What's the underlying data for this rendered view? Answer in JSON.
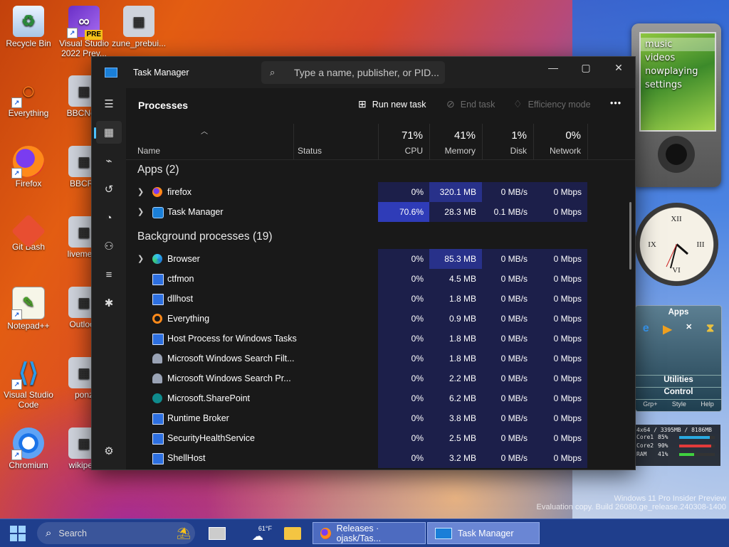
{
  "desktop": {
    "icons": [
      {
        "label": "Recycle Bin",
        "icon": "recycle-bin-icon"
      },
      {
        "label": "Visual Studio 2022 Prev...",
        "icon": "visual-studio-preview-icon",
        "badge": "PRE"
      },
      {
        "label": "zune_prebui...",
        "icon": "zune-prebuilt-icon"
      },
      {
        "label": "Everything",
        "icon": "everything-search-icon"
      },
      {
        "label": "BBCNew",
        "icon": "bbc-news-icon"
      },
      {
        "label": "Firefox",
        "icon": "firefox-icon"
      },
      {
        "label": "BBCRa",
        "icon": "bbc-radio-icon"
      },
      {
        "label": "Git Bash",
        "icon": "git-bash-icon"
      },
      {
        "label": "livemess",
        "icon": "livemessenger-icon"
      },
      {
        "label": "Notepad++",
        "icon": "notepad-plus-plus-icon"
      },
      {
        "label": "Outlook",
        "icon": "outlook-icon"
      },
      {
        "label": "Visual Studio Code",
        "icon": "vscode-icon"
      },
      {
        "label": "ponz",
        "icon": "ponz-icon"
      },
      {
        "label": "Chromium",
        "icon": "chromium-icon"
      },
      {
        "label": "wikipedi",
        "icon": "wikipedia-icon"
      }
    ]
  },
  "window": {
    "title": "Task Manager",
    "search_placeholder": "Type a name, publisher, or PID...",
    "controls": {
      "minimize": "—",
      "maximize": "▢",
      "close": "✕"
    }
  },
  "toolbar": {
    "page_title": "Processes",
    "run_new_task": "Run new task",
    "end_task": "End task",
    "efficiency_mode": "Efficiency mode",
    "more": "•••"
  },
  "columns": {
    "name": "Name",
    "status": "Status",
    "cpu": {
      "pct": "71%",
      "label": "CPU"
    },
    "memory": {
      "pct": "41%",
      "label": "Memory"
    },
    "disk": {
      "pct": "1%",
      "label": "Disk"
    },
    "network": {
      "pct": "0%",
      "label": "Network"
    }
  },
  "sections": {
    "apps": "Apps (2)",
    "background": "Background processes (19)"
  },
  "apps": [
    {
      "name": "firefox",
      "cpu": "0%",
      "memory": "320.1 MB",
      "disk": "0 MB/s",
      "network": "0 Mbps",
      "icon": "firefox-icon",
      "expandable": true
    },
    {
      "name": "Task Manager",
      "cpu": "70.6%",
      "memory": "28.3 MB",
      "disk": "0.1 MB/s",
      "network": "0 Mbps",
      "icon": "task-manager-icon",
      "expandable": true
    }
  ],
  "background": [
    {
      "name": "Browser",
      "cpu": "0%",
      "memory": "85.3 MB",
      "disk": "0 MB/s",
      "network": "0 Mbps",
      "icon": "edge-icon",
      "expandable": true
    },
    {
      "name": "ctfmon",
      "cpu": "0%",
      "memory": "4.5 MB",
      "disk": "0 MB/s",
      "network": "0 Mbps",
      "icon": "app-window-icon",
      "expandable": false
    },
    {
      "name": "dllhost",
      "cpu": "0%",
      "memory": "1.8 MB",
      "disk": "0 MB/s",
      "network": "0 Mbps",
      "icon": "app-window-icon",
      "expandable": false
    },
    {
      "name": "Everything",
      "cpu": "0%",
      "memory": "0.9 MB",
      "disk": "0 MB/s",
      "network": "0 Mbps",
      "icon": "everything-search-icon",
      "expandable": false
    },
    {
      "name": "Host Process for Windows Tasks",
      "cpu": "0%",
      "memory": "1.8 MB",
      "disk": "0 MB/s",
      "network": "0 Mbps",
      "icon": "app-window-icon",
      "expandable": false
    },
    {
      "name": "Microsoft Windows Search Filt...",
      "cpu": "0%",
      "memory": "1.8 MB",
      "disk": "0 MB/s",
      "network": "0 Mbps",
      "icon": "search-service-icon",
      "expandable": false
    },
    {
      "name": "Microsoft Windows Search Pr...",
      "cpu": "0%",
      "memory": "2.2 MB",
      "disk": "0 MB/s",
      "network": "0 Mbps",
      "icon": "search-service-icon",
      "expandable": false
    },
    {
      "name": "Microsoft.SharePoint",
      "cpu": "0%",
      "memory": "6.2 MB",
      "disk": "0 MB/s",
      "network": "0 Mbps",
      "icon": "sharepoint-icon",
      "expandable": false
    },
    {
      "name": "Runtime Broker",
      "cpu": "0%",
      "memory": "3.8 MB",
      "disk": "0 MB/s",
      "network": "0 Mbps",
      "icon": "app-window-icon",
      "expandable": false
    },
    {
      "name": "SecurityHealthService",
      "cpu": "0%",
      "memory": "2.5 MB",
      "disk": "0 MB/s",
      "network": "0 Mbps",
      "icon": "app-window-icon",
      "expandable": false
    },
    {
      "name": "ShellHost",
      "cpu": "0%",
      "memory": "3.2 MB",
      "disk": "0 MB/s",
      "network": "0 Mbps",
      "icon": "app-window-icon",
      "expandable": false
    }
  ],
  "zune_gadget": {
    "menu": [
      "music",
      "videos",
      "nowplaying",
      "settings"
    ]
  },
  "apps_gadget": {
    "title": "Apps",
    "utilities": "Utilities",
    "control": "Control",
    "footer": [
      "Grp+",
      "Style",
      "Help"
    ]
  },
  "sysmon_gadget": {
    "header": "4x64 / 3395MB / 8186MB",
    "rows": [
      {
        "label": "Core1",
        "value": "85%",
        "fill": 0.85,
        "color": "#29a9e0"
      },
      {
        "label": "Core2",
        "value": "90%",
        "fill": 0.9,
        "color": "#e23a3a"
      },
      {
        "label": "RAM",
        "value": "41%",
        "fill": 0.41,
        "color": "#3fd13f"
      }
    ]
  },
  "watermark": {
    "line1": "Windows 11 Pro Insider Preview",
    "line2": "Evaluation copy. Build 26080.ge_release.240308-1400"
  },
  "taskbar": {
    "search_label": "Search",
    "weather_temp": "61°F",
    "tasks": [
      {
        "label": "Releases · ojask/Tas...",
        "icon": "firefox-icon"
      },
      {
        "label": "Task Manager",
        "icon": "task-manager-icon"
      }
    ]
  },
  "colors": {
    "accent": "#4cc2ff",
    "heat_low": "#1c1f4a",
    "heat_mid": "#28318a",
    "heat_high": "#2f3cb8"
  }
}
